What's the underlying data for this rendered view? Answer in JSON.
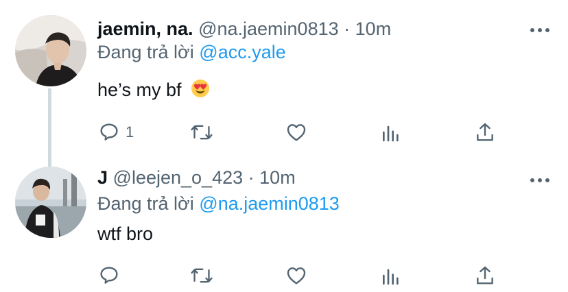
{
  "tweets": [
    {
      "name": "jaemin, na.",
      "handle": "@na.jaemin0813",
      "separator": "·",
      "time": "10m",
      "reply_prefix": "Đang trả lời",
      "reply_to": "@acc.yale",
      "text": "he’s my bf",
      "emoji": "heart-eyes-emoji",
      "reply_count": "1"
    },
    {
      "name": "J",
      "handle": "@leejen_o_423",
      "separator": "·",
      "time": "10m",
      "reply_prefix": "Đang trả lời",
      "reply_to": "@na.jaemin0813",
      "text": "wtf bro",
      "reply_count": ""
    }
  ],
  "colors": {
    "text": "#0f1419",
    "secondary": "#536471",
    "link": "#1d9bf0",
    "thread_line": "#cfd9de"
  },
  "icons": [
    "reply-icon",
    "retweet-icon",
    "like-icon",
    "analytics-icon",
    "share-icon",
    "more-icon"
  ]
}
